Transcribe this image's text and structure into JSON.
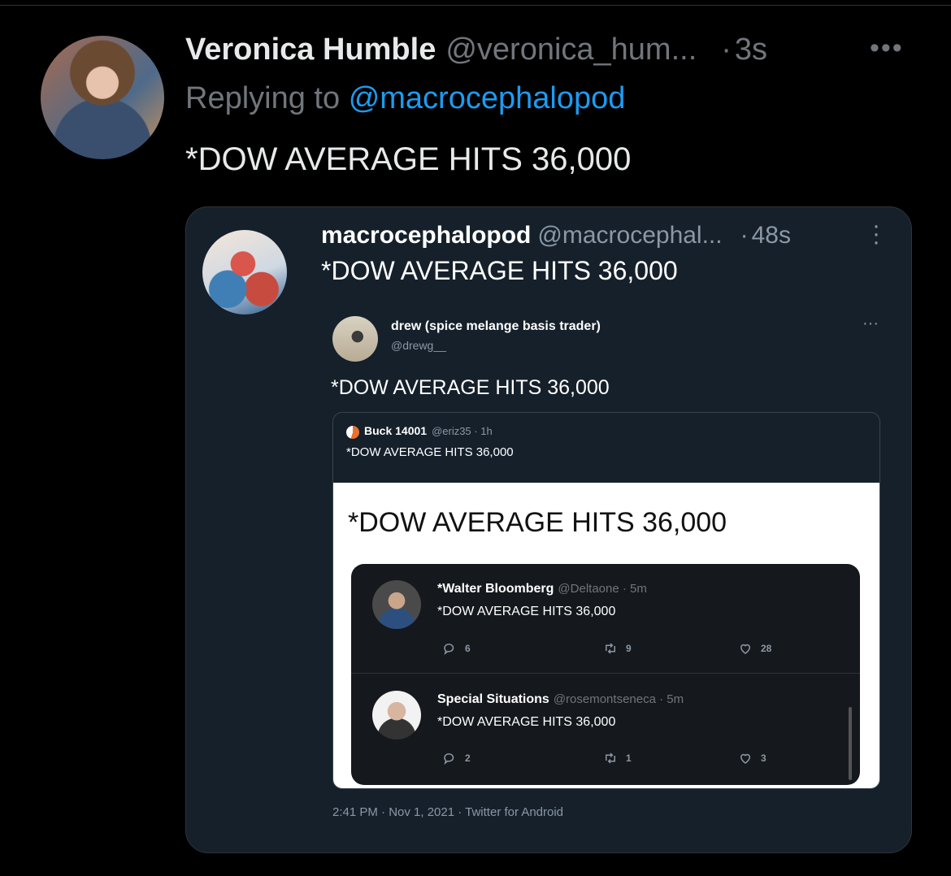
{
  "reply": {
    "display_name": "Veronica Humble",
    "handle": "@veronica_hum...",
    "time": "3s",
    "replying_prefix": "Replying to",
    "replying_mention": "@macrocephalopod",
    "text": "*DOW AVERAGE HITS 36,000"
  },
  "quoted": {
    "display_name": "macrocephalopod",
    "handle": "@macrocephal...",
    "time": "48s",
    "text": "*DOW AVERAGE HITS 36,000",
    "screenshot": {
      "author_name": "drew (spice melange basis trader)",
      "author_handle": "@drewg__",
      "text": "*DOW AVERAGE HITS 36,000",
      "nested": {
        "author_name": "Buck 14001",
        "author_meta": "@eriz35 · 1h",
        "text": "*DOW AVERAGE HITS 36,000",
        "image_headline": "*DOW AVERAGE HITS 36,000",
        "tweets": [
          {
            "name": "*Walter Bloomberg",
            "meta": "@Deltaone · 5m",
            "text": "*DOW AVERAGE HITS 36,000",
            "replies": "6",
            "retweets": "9",
            "likes": "28"
          },
          {
            "name": "Special Situations",
            "meta": "@rosemontseneca · 5m",
            "text": "*DOW AVERAGE HITS 36,000",
            "replies": "2",
            "retweets": "1",
            "likes": "3"
          }
        ]
      },
      "footer": "2:41 PM · Nov 1, 2021 · Twitter for Android"
    }
  },
  "icons": [
    "more-icon",
    "reply-icon",
    "retweet-icon",
    "like-icon"
  ],
  "colors": {
    "background": "#000000",
    "link": "#1d9bf0",
    "card": "#15202b"
  }
}
